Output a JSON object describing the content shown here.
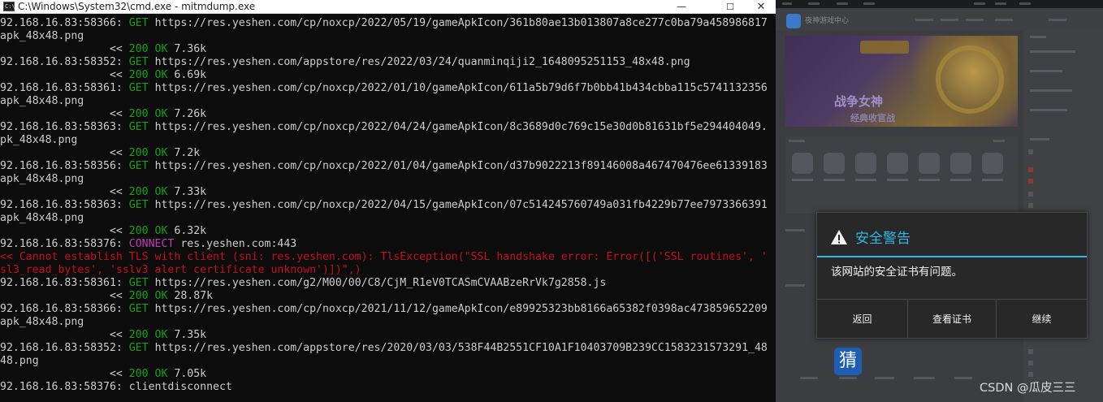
{
  "cmd_window": {
    "title": "C:\\Windows\\System32\\cmd.exe - mitmdump.exe",
    "icon_text": "C:\\",
    "controls": {
      "minimize": "—",
      "maximize": "☐",
      "close": "✕"
    }
  },
  "console_lines": [
    [
      {
        "t": "92.168.16.83:58366: ",
        "c": ""
      },
      {
        "t": "GET",
        "c": "get"
      },
      {
        "t": " https://res.yeshen.com/cp/noxcp/2022/05/19/gameApkIcon/361b80ae13b013807a8ce277c0ba79a458986817",
        "c": ""
      }
    ],
    [
      {
        "t": "apk_48x48.png",
        "c": ""
      }
    ],
    [
      {
        "t": "                 << ",
        "c": ""
      },
      {
        "t": "200 OK",
        "c": "ok"
      },
      {
        "t": " 7.36k",
        "c": ""
      }
    ],
    [
      {
        "t": "92.168.16.83:58352: ",
        "c": ""
      },
      {
        "t": "GET",
        "c": "get"
      },
      {
        "t": " https://res.yeshen.com/appstore/res/2022/03/24/quanminqiji2_1648095251153_48x48.png",
        "c": ""
      }
    ],
    [
      {
        "t": "                 << ",
        "c": ""
      },
      {
        "t": "200 OK",
        "c": "ok"
      },
      {
        "t": " 6.69k",
        "c": ""
      }
    ],
    [
      {
        "t": "92.168.16.83:58361: ",
        "c": ""
      },
      {
        "t": "GET",
        "c": "get"
      },
      {
        "t": " https://res.yeshen.com/cp/noxcp/2022/01/10/gameApkIcon/611a5b79d6f7b0bb41b434cbba115c5741132356",
        "c": ""
      }
    ],
    [
      {
        "t": "apk_48x48.png",
        "c": ""
      }
    ],
    [
      {
        "t": "                 << ",
        "c": ""
      },
      {
        "t": "200 OK",
        "c": "ok"
      },
      {
        "t": " 7.26k",
        "c": ""
      }
    ],
    [
      {
        "t": "92.168.16.83:58363: ",
        "c": ""
      },
      {
        "t": "GET",
        "c": "get"
      },
      {
        "t": " https://res.yeshen.com/cp/noxcp/2022/04/24/gameApkIcon/8c3689d0c769c15e30d0b81631bf5e294404049.",
        "c": ""
      }
    ],
    [
      {
        "t": "pk_48x48.png",
        "c": ""
      }
    ],
    [
      {
        "t": "                 << ",
        "c": ""
      },
      {
        "t": "200 OK",
        "c": "ok"
      },
      {
        "t": " 7.2k",
        "c": ""
      }
    ],
    [
      {
        "t": "92.168.16.83:58356: ",
        "c": ""
      },
      {
        "t": "GET",
        "c": "get"
      },
      {
        "t": " https://res.yeshen.com/cp/noxcp/2022/01/04/gameApkIcon/d37b9022213f89146008a467470476ee61339183",
        "c": ""
      }
    ],
    [
      {
        "t": "apk_48x48.png",
        "c": ""
      }
    ],
    [
      {
        "t": "                 << ",
        "c": ""
      },
      {
        "t": "200 OK",
        "c": "ok"
      },
      {
        "t": " 7.33k",
        "c": ""
      }
    ],
    [
      {
        "t": "92.168.16.83:58363: ",
        "c": ""
      },
      {
        "t": "GET",
        "c": "get"
      },
      {
        "t": " https://res.yeshen.com/cp/noxcp/2022/04/15/gameApkIcon/07c514245760749a031fb4229b77ee7973366391",
        "c": ""
      }
    ],
    [
      {
        "t": "apk_48x48.png",
        "c": ""
      }
    ],
    [
      {
        "t": "                 << ",
        "c": ""
      },
      {
        "t": "200 OK",
        "c": "ok"
      },
      {
        "t": " 6.32k",
        "c": ""
      }
    ],
    [
      {
        "t": "92.168.16.83:58376: ",
        "c": ""
      },
      {
        "t": "CONNECT",
        "c": "conn"
      },
      {
        "t": " res.yeshen.com:443",
        "c": ""
      }
    ],
    [
      {
        "t": "<< Cannot establish TLS with client (sni: res.yeshen.com): TlsException(\"SSL handshake error: Error([('SSL routines', '",
        "c": "err"
      }
    ],
    [
      {
        "t": "sl3_read_bytes', 'sslv3 alert certificate unknown')])\",)",
        "c": "err"
      }
    ],
    [
      {
        "t": "92.168.16.83:58361: ",
        "c": ""
      },
      {
        "t": "GET",
        "c": "get"
      },
      {
        "t": " https://res.yeshen.com/g2/M00/00/C8/CjM_R1eV0TCASmCVAABzeRrVk7g2858.js",
        "c": ""
      }
    ],
    [
      {
        "t": "                 << ",
        "c": ""
      },
      {
        "t": "200 OK",
        "c": "ok"
      },
      {
        "t": " 28.87k",
        "c": ""
      }
    ],
    [
      {
        "t": "92.168.16.83:58366: ",
        "c": ""
      },
      {
        "t": "GET",
        "c": "get"
      },
      {
        "t": " https://res.yeshen.com/cp/noxcp/2021/11/12/gameApkIcon/e89925323bb8166a65382f0398ac473859652209",
        "c": ""
      }
    ],
    [
      {
        "t": "apk_48x48.png",
        "c": ""
      }
    ],
    [
      {
        "t": "                 << ",
        "c": ""
      },
      {
        "t": "200 OK",
        "c": "ok"
      },
      {
        "t": " 7.35k",
        "c": ""
      }
    ],
    [
      {
        "t": "92.168.16.83:58352: ",
        "c": ""
      },
      {
        "t": "GET",
        "c": "get"
      },
      {
        "t": " https://res.yeshen.com/appstore/res/2020/03/03/538F44B2551CF10A1F10403709B239CC1583231573291_48",
        "c": ""
      }
    ],
    [
      {
        "t": "48.png",
        "c": ""
      }
    ],
    [
      {
        "t": "                 << ",
        "c": ""
      },
      {
        "t": "200 OK",
        "c": "ok"
      },
      {
        "t": " 7.05k",
        "c": ""
      }
    ],
    [
      {
        "t": "92.168.16.83:58376: clientdisconnect",
        "c": ""
      }
    ]
  ],
  "store": {
    "logo_text": "夜神游戏中心",
    "banner_title": "战争女神",
    "banner_subtitle": "经典收官战",
    "yx_icon_glyph": "猜"
  },
  "dialog": {
    "title": "安全警告",
    "message": "该网站的安全证书有问题。",
    "buttons": {
      "back": "返回",
      "view_cert": "查看证书",
      "continue": "继续"
    }
  },
  "watermark": "CSDN @瓜皮三三",
  "colors": {
    "console_bg": "#0c0c0c",
    "console_text": "#cccccc",
    "ok_green": "#13a10e",
    "connect_magenta": "#c239b3",
    "error_red": "#c50f1f",
    "dialog_accent": "#33b5e5"
  }
}
